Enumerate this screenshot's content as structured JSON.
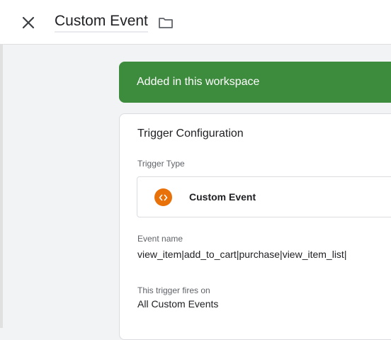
{
  "header": {
    "title": "Custom Event"
  },
  "banner": {
    "text": "Added in this workspace",
    "color": "#3d8b3d"
  },
  "trigger_config": {
    "title": "Trigger Configuration",
    "type_label": "Trigger Type",
    "type_value": "Custom Event",
    "type_icon": "custom-event-code-icon",
    "type_icon_color": "#e8710a",
    "event_name_label": "Event name",
    "event_name_value": "view_item|add_to_cart|purchase|view_item_list|",
    "fires_on_label": "This trigger fires on",
    "fires_on_value": "All Custom Events"
  }
}
